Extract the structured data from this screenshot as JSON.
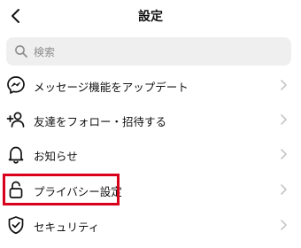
{
  "header": {
    "title": "設定",
    "back_icon": "chevron-left-icon"
  },
  "search": {
    "placeholder": "検索",
    "icon": "search-icon"
  },
  "menu": {
    "items": [
      {
        "label": "メッセージ機能をアップデート",
        "icon": "messenger-icon"
      },
      {
        "label": "友達をフォロー・招待する",
        "icon": "add-person-icon"
      },
      {
        "label": "お知らせ",
        "icon": "bell-icon"
      },
      {
        "label": "プライバシー設定",
        "icon": "lock-icon",
        "highlighted": true
      },
      {
        "label": "セキュリティ",
        "icon": "shield-check-icon"
      }
    ]
  },
  "colors": {
    "highlight": "#d9001b",
    "search_bg": "#efefef",
    "placeholder": "#8e8e8e",
    "chevron": "#c7c7c7"
  }
}
